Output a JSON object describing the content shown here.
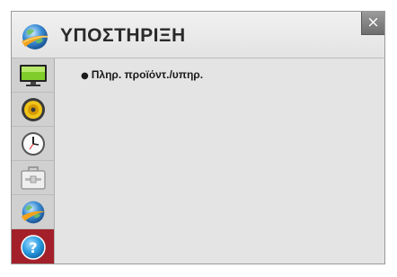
{
  "header": {
    "title": "ΥΠΟΣΤΗΡΙΞΗ",
    "icon": "globe-support-icon",
    "close_label": "×"
  },
  "sidebar": {
    "items": [
      {
        "icon": "picture-monitor-icon"
      },
      {
        "icon": "audio-speaker-icon"
      },
      {
        "icon": "clock-icon"
      },
      {
        "icon": "toolbox-icon"
      },
      {
        "icon": "globe-network-icon"
      },
      {
        "icon": "question-help-icon",
        "active": true
      }
    ]
  },
  "content": {
    "entries": [
      {
        "bullet": "●",
        "label": "Πληρ. προϊόντ./υπηρ."
      }
    ]
  },
  "colors": {
    "active_item": "#a3202a",
    "panel_bg": "#e4e4e4",
    "sidebar_bg": "#d0d0d0",
    "close_button": "#7a7a7a"
  }
}
